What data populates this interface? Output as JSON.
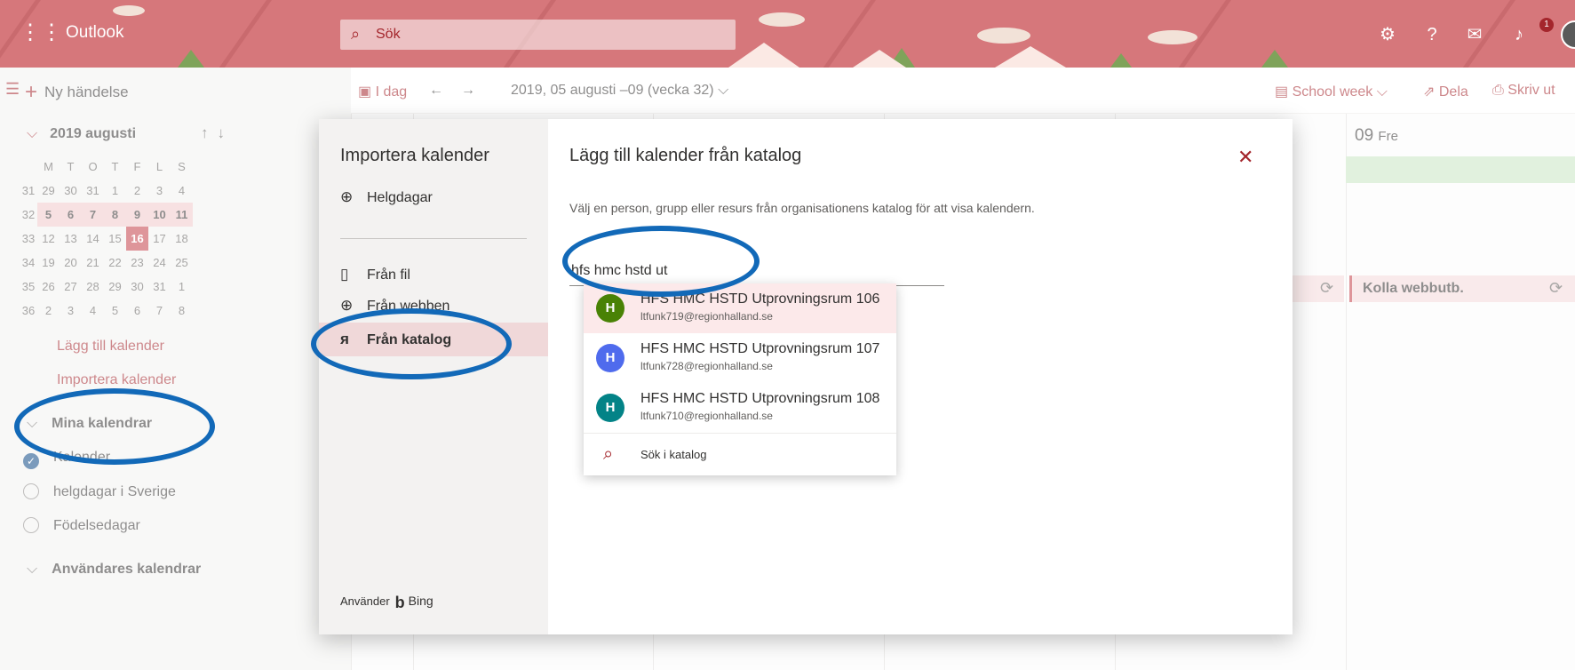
{
  "header": {
    "app_name": "Outlook",
    "search_placeholder": "Sök",
    "notification_count": "1",
    "icons": [
      "app-launcher-icon",
      "search-icon",
      "settings-icon",
      "help-icon",
      "feedback-icon",
      "notifications-icon"
    ]
  },
  "left_pane": {
    "new_event": "Ny händelse",
    "mini_calendar": {
      "title": "2019 augusti",
      "weekday_headers": [
        "M",
        "T",
        "O",
        "T",
        "F",
        "L",
        "S"
      ],
      "weeks": [
        {
          "week": "31",
          "days": [
            "29",
            "30",
            "31",
            "1",
            "2",
            "3",
            "4"
          ]
        },
        {
          "week": "32",
          "days": [
            "5",
            "6",
            "7",
            "8",
            "9",
            "10",
            "11"
          ]
        },
        {
          "week": "33",
          "days": [
            "12",
            "13",
            "14",
            "15",
            "16",
            "17",
            "18"
          ]
        },
        {
          "week": "34",
          "days": [
            "19",
            "20",
            "21",
            "22",
            "23",
            "24",
            "25"
          ]
        },
        {
          "week": "35",
          "days": [
            "26",
            "27",
            "28",
            "29",
            "30",
            "31",
            "1"
          ]
        },
        {
          "week": "36",
          "days": [
            "2",
            "3",
            "4",
            "5",
            "6",
            "7",
            "8"
          ]
        }
      ],
      "selected_week": "32",
      "today": "16"
    },
    "add_calendar": "Lägg till kalender",
    "import_calendar": "Importera kalender",
    "my_calendars_header": "Mina kalendrar",
    "calendars": [
      {
        "name": "Kalender",
        "checked": true
      },
      {
        "name": "helgdagar i Sverige",
        "checked": false
      },
      {
        "name": "Födelsedagar",
        "checked": false
      }
    ],
    "users_calendars_header": "Användares kalendrar"
  },
  "toolbar": {
    "today": "I dag",
    "date_range": "2019, 05 augusti –09 (vecka 32)",
    "view": "School week",
    "share": "Dela",
    "print": "Skriv ut"
  },
  "calendar": {
    "day_number": "09",
    "day_name": "Fre",
    "event_title": "Kolla webbutb."
  },
  "dialog": {
    "nav_title": "Importera kalender",
    "nav_items": [
      {
        "label": "Helgdagar",
        "icon": "globe-icon"
      },
      {
        "label": "Från fil",
        "icon": "file-import-icon"
      },
      {
        "label": "Från webben",
        "icon": "globe-icon"
      },
      {
        "label": "Från katalog",
        "icon": "directory-icon"
      }
    ],
    "powered_by_prefix": "Använder",
    "powered_by": "Bing",
    "title": "Lägg till kalender från katalog",
    "description": "Välj en person, grupp eller resurs från organisationens katalog för att visa kalendern.",
    "search_value": "hfs hmc hstd ut",
    "suggestions": [
      {
        "initial": "H",
        "name": "HFS HMC HSTD Utprovningsrum 106",
        "email": "ltfunk719@regionhalland.se",
        "color": "#498205"
      },
      {
        "initial": "H",
        "name": "HFS HMC HSTD Utprovningsrum 107",
        "email": "ltfunk728@regionhalland.se",
        "color": "#4f6bed"
      },
      {
        "initial": "H",
        "name": "HFS HMC HSTD Utprovningsrum 108",
        "email": "ltfunk710@regionhalland.se",
        "color": "#038387"
      }
    ],
    "search_directory": "Sök i katalog"
  },
  "colors": {
    "accent": "#a4262c",
    "annotation": "#1269b8"
  }
}
